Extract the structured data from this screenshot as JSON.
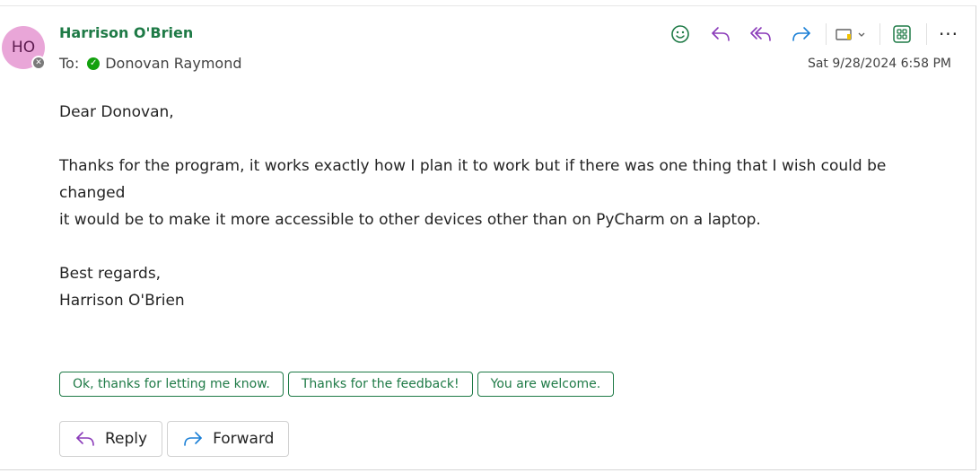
{
  "sender": {
    "initials": "HO",
    "name": "Harrison O'Brien",
    "avatar_color": "#e9a6d8",
    "presence_status": "blocked"
  },
  "recipients": {
    "to_label": "To:",
    "to_name": "Donovan Raymond"
  },
  "datetime": "Sat 9/28/2024 6:58 PM",
  "toolbar": {
    "icons": [
      "emoji-icon",
      "reply-icon",
      "reply-all-icon",
      "forward-icon",
      "label-icon",
      "apps-icon",
      "more-icon"
    ],
    "more_label": "···"
  },
  "body": {
    "greeting": "Dear Donovan,",
    "paragraph_line1": "Thanks for the program, it works exactly how I plan it to work but if there was one thing that I wish could be changed",
    "paragraph_line2": "it would be to make it more accessible to other devices other than on PyCharm on a laptop.",
    "closing": "Best regards,",
    "signature": "Harrison O'Brien"
  },
  "suggested_replies": [
    "Ok, thanks for letting me know.",
    "Thanks for the feedback!",
    "You are welcome."
  ],
  "actions": {
    "reply_label": "Reply",
    "forward_label": "Forward"
  },
  "colors": {
    "accent_green": "#1e7a46",
    "reply_purple": "#8a3ab9",
    "forward_blue": "#1a7fd6"
  }
}
